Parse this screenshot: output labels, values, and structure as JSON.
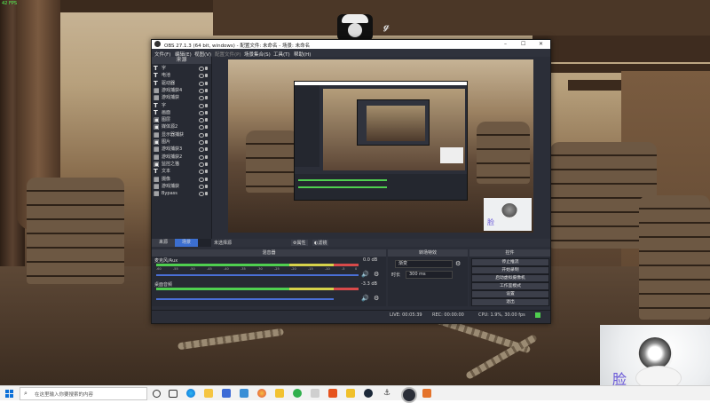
{
  "game": {
    "fps_text": "42 FPS"
  },
  "obs": {
    "title": "OBS 27.1.3 (64 bit, windows) - 配置文件: 未命名 - 场景: 未命名",
    "window_controls": [
      "–",
      "☐",
      "✕"
    ],
    "menu": [
      "文件(F)",
      "编辑(E)",
      "视图(V)",
      "配置文件(P)",
      "场景集合(S)",
      "工具(T)",
      "帮助(H)"
    ],
    "sources": {
      "header": "来源",
      "items": [
        {
          "icon": "T",
          "label": "字"
        },
        {
          "icon": "T",
          "label": "电池"
        },
        {
          "icon": "T",
          "label": "驱动器"
        },
        {
          "icon": "▦",
          "label": "游戏捕获4"
        },
        {
          "icon": "▦",
          "label": "游戏捕获"
        },
        {
          "icon": "T",
          "label": "字"
        },
        {
          "icon": "T",
          "label": "画面"
        },
        {
          "icon": "▣",
          "label": "图层"
        },
        {
          "icon": "▣",
          "label": "媒体源2"
        },
        {
          "icon": "▦",
          "label": "显示器捕获"
        },
        {
          "icon": "▣",
          "label": "图片"
        },
        {
          "icon": "▦",
          "label": "游戏捕获3"
        },
        {
          "icon": "▦",
          "label": "游戏捕获2"
        },
        {
          "icon": "▣",
          "label": "监控之猫"
        },
        {
          "icon": "T",
          "label": "文本"
        },
        {
          "icon": "▦",
          "label": "摄像"
        },
        {
          "icon": "▦",
          "label": "游戏捕获"
        },
        {
          "icon": "▦",
          "label": "Bypass"
        }
      ],
      "tools": [
        "+",
        "−",
        "⚙",
        "∧",
        "∨"
      ],
      "tabs": [
        "来源",
        "场景"
      ]
    },
    "scene_bar": {
      "no_source": "未选择源",
      "properties": "属性",
      "filters": "滤镜"
    },
    "mixer": {
      "header": "混音器",
      "channels": [
        {
          "name": "麦克风/Aux",
          "db": "0.0 dB"
        },
        {
          "name": "桌面音频",
          "db": "-3.3 dB"
        }
      ],
      "ticks": [
        "-60",
        "-55",
        "-50",
        "-45",
        "-40",
        "-35",
        "-30",
        "-25",
        "-20",
        "-15",
        "-10",
        "-5",
        "0"
      ]
    },
    "transitions": {
      "header": "转场特效",
      "type": "渐变",
      "duration_label": "时长",
      "duration": "300 ms"
    },
    "controls": {
      "header": "控件",
      "buttons": [
        "停止推流",
        "开始录制",
        "启动虚拟摄像机",
        "工作室模式",
        "设置",
        "退出"
      ]
    },
    "status": {
      "live": "LIVE: 00:05:39",
      "rec": "REC: 00:00:00",
      "cpu": "CPU: 1.9%, 30.00 fps"
    }
  },
  "cam_overlay": {
    "label": "脸"
  },
  "taskbar": {
    "search_placeholder": "在这里输入你要搜索的内容"
  }
}
